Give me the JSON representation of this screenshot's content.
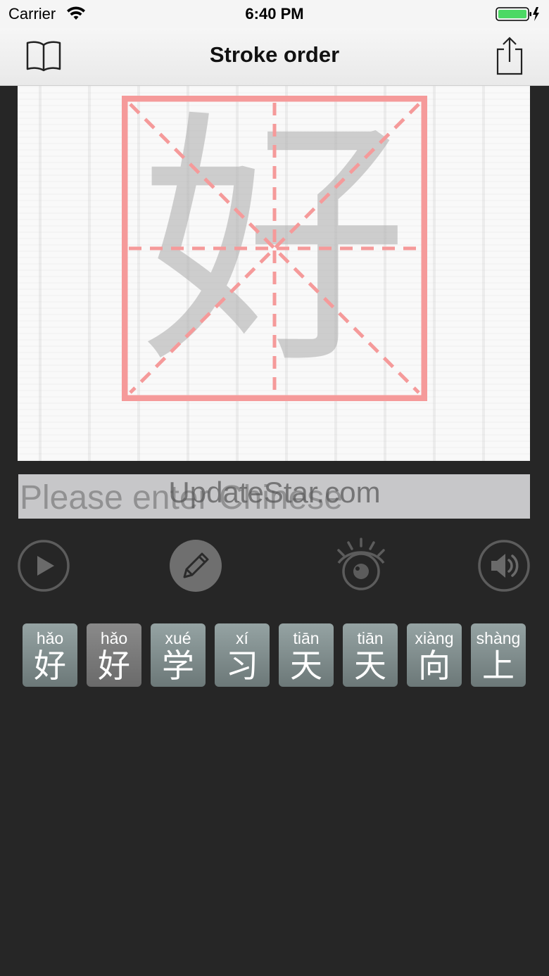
{
  "status_bar": {
    "carrier": "Carrier",
    "time": "6:40 PM"
  },
  "nav": {
    "title": "Stroke order",
    "book_icon": "book-icon",
    "share_icon": "share-icon"
  },
  "canvas": {
    "grid_color": "#f59a9a",
    "character": "好"
  },
  "input": {
    "placeholder": "Please enter Chinese",
    "value": ""
  },
  "watermark": "UpdateStar.com",
  "controls": {
    "play_icon": "play-icon",
    "pencil_icon": "pencil-icon",
    "eye_icon": "eye-icon",
    "speaker_icon": "speaker-icon"
  },
  "characters": [
    {
      "pinyin": "hǎo",
      "hanzi": "好"
    },
    {
      "pinyin": "hǎo",
      "hanzi": "好"
    },
    {
      "pinyin": "xué",
      "hanzi": "学"
    },
    {
      "pinyin": "xí",
      "hanzi": "习"
    },
    {
      "pinyin": "tiān",
      "hanzi": "天"
    },
    {
      "pinyin": "tiān",
      "hanzi": "天"
    },
    {
      "pinyin": "xiàng",
      "hanzi": "向"
    },
    {
      "pinyin": "shàng",
      "hanzi": "上"
    }
  ],
  "colors": {
    "background": "#262626",
    "tile": "#7f8c8c",
    "grid": "#f59a9a"
  }
}
